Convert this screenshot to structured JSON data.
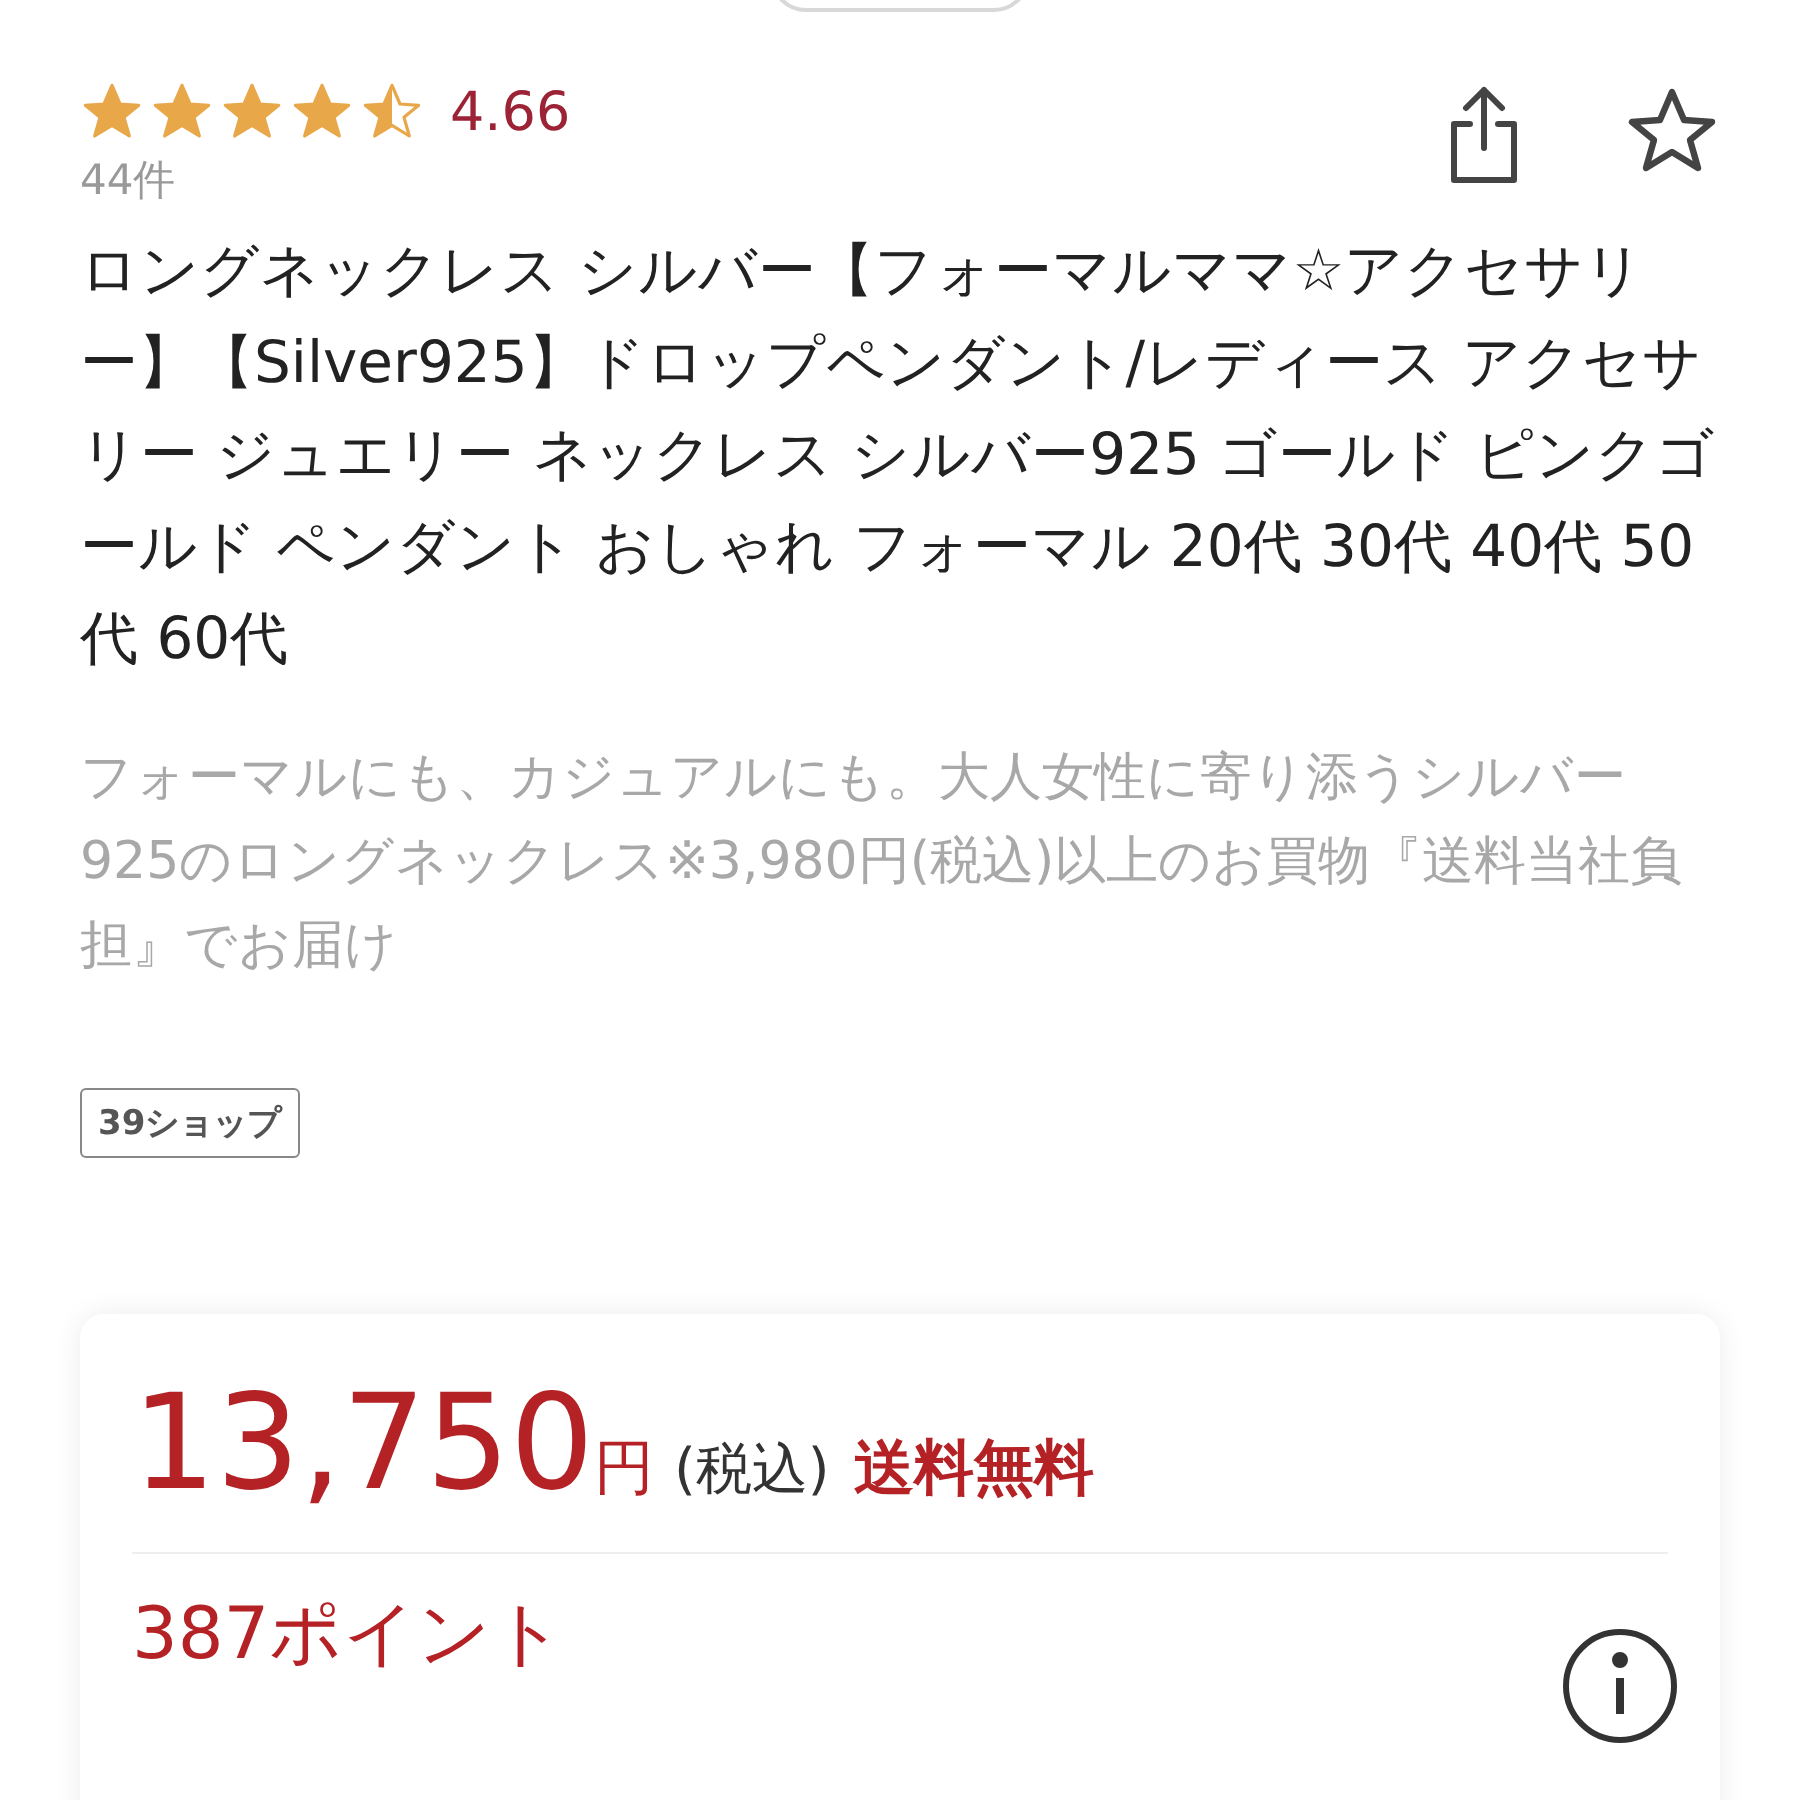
{
  "rating": {
    "stars": 4.5,
    "score": "4.66",
    "count": "44件"
  },
  "title": "ロングネックレス シルバー【フォーマルママ☆アクセサリー】【Silver925】ドロップペンダント/レディース アクセサリー ジュエリー ネックレス シルバー925 ゴールド ピンクゴールド ペンダント おしゃれ フォーマル 20代 30代 40代 50代 60代",
  "description": "フォーマルにも、カジュアルにも。大人女性に寄り添うシルバー925のロングネックレス※3,980円(税込)以上のお買物『送料当社負担』でお届け",
  "shop_tag": "39ショップ",
  "price": {
    "amount": "13,750",
    "unit": "円",
    "tax": "(税込)",
    "shipping": "送料無料"
  },
  "points": "387ポイント"
}
